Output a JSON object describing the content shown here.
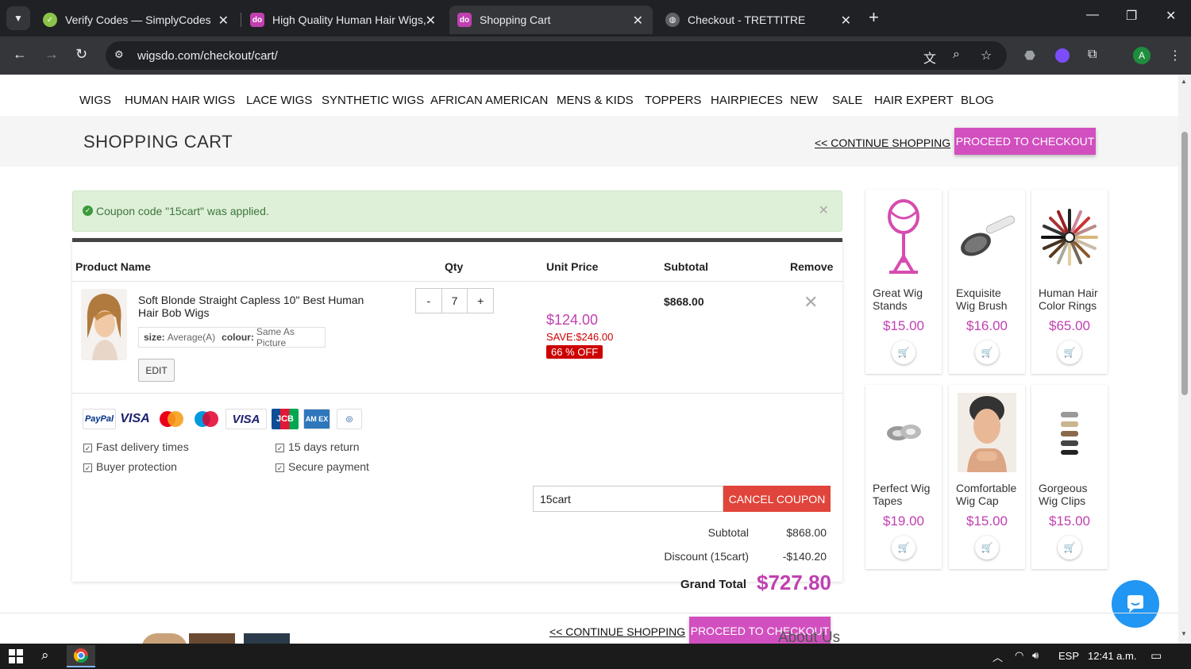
{
  "browser": {
    "tabs": [
      {
        "title": "Verify Codes — SimplyCodes",
        "icon": "simplycodes-icon",
        "active": false
      },
      {
        "title": "High Quality Human Hair Wigs,",
        "icon": "wigsdo-icon",
        "active": false
      },
      {
        "title": "Shopping Cart",
        "icon": "wigsdo-icon",
        "active": true
      },
      {
        "title": "Checkout - TRETTITRE",
        "icon": "globe-icon",
        "active": false
      }
    ],
    "url": "wigsdo.com/checkout/cart/",
    "profile_initial": "A"
  },
  "site_nav": [
    "WIGS",
    "HUMAN HAIR WIGS",
    "LACE WIGS",
    "SYNTHETIC WIGS",
    "AFRICAN AMERICAN",
    "MENS & KIDS",
    "TOPPERS",
    "HAIRPIECES",
    "NEW",
    "SALE",
    "HAIR EXPERT",
    "BLOG"
  ],
  "cart_header": {
    "title": "SHOPPING CART",
    "continue_label": "<< CONTINUE SHOPPING",
    "checkout_label": "PROCEED TO CHECKOUT"
  },
  "alert": {
    "message": "Coupon code \"15cart\" was applied."
  },
  "table": {
    "headers": {
      "product": "Product Name",
      "qty": "Qty",
      "unit_price": "Unit Price",
      "subtotal": "Subtotal",
      "remove": "Remove"
    }
  },
  "item": {
    "name": "Soft Blonde Straight Capless 10\" Best Human Hair Bob Wigs",
    "size_label": "size:",
    "size_value": "Average(A)",
    "colour_label": "colour:",
    "colour_value": "Same As Picture",
    "edit_label": "EDIT",
    "qty_minus": "-",
    "qty": "7",
    "qty_plus": "+",
    "unit_price": "$124.00",
    "save": "SAVE:$246.00",
    "off": "66 % OFF",
    "subtotal": "$868.00"
  },
  "payment_icons": [
    "PayPal",
    "VISA",
    "Mastercard",
    "Maestro",
    "VISA Electron",
    "JCB",
    "American Express",
    "Diners Club"
  ],
  "features": [
    "Fast delivery times",
    "15 days return",
    "Buyer protection",
    "Secure payment"
  ],
  "coupon": {
    "value": "15cart",
    "cancel_label": "CANCEL COUPON"
  },
  "totals": {
    "subtotal_label": "Subtotal",
    "subtotal_value": "$868.00",
    "discount_label": "Discount (15cart)",
    "discount_value": "-$140.20",
    "grand_label": "Grand Total",
    "grand_value": "$727.80"
  },
  "bottom_links": {
    "continue_label": "<< CONTINUE SHOPPING",
    "checkout_label": "PROCEED TO CHECKOUT"
  },
  "side_products": [
    {
      "name": "Great Wig Stands",
      "price": "$15.00"
    },
    {
      "name": "Exquisite Wig Brush",
      "price": "$16.00"
    },
    {
      "name": "Human Hair Color Rings",
      "price": "$65.00"
    },
    {
      "name": "Perfect Wig Tapes",
      "price": "$19.00"
    },
    {
      "name": "Comfortable Wig Cap",
      "price": "$15.00"
    },
    {
      "name": "Gorgeous Wig Clips",
      "price": "$15.00"
    }
  ],
  "footer": {
    "about_us": "About Us"
  },
  "taskbar": {
    "lang": "ESP",
    "time": "12:41 a.m."
  },
  "colors": {
    "accent": "#d14fbf",
    "price": "#c040b0",
    "danger": "#e0443a",
    "alert_bg": "#dff0d8"
  }
}
